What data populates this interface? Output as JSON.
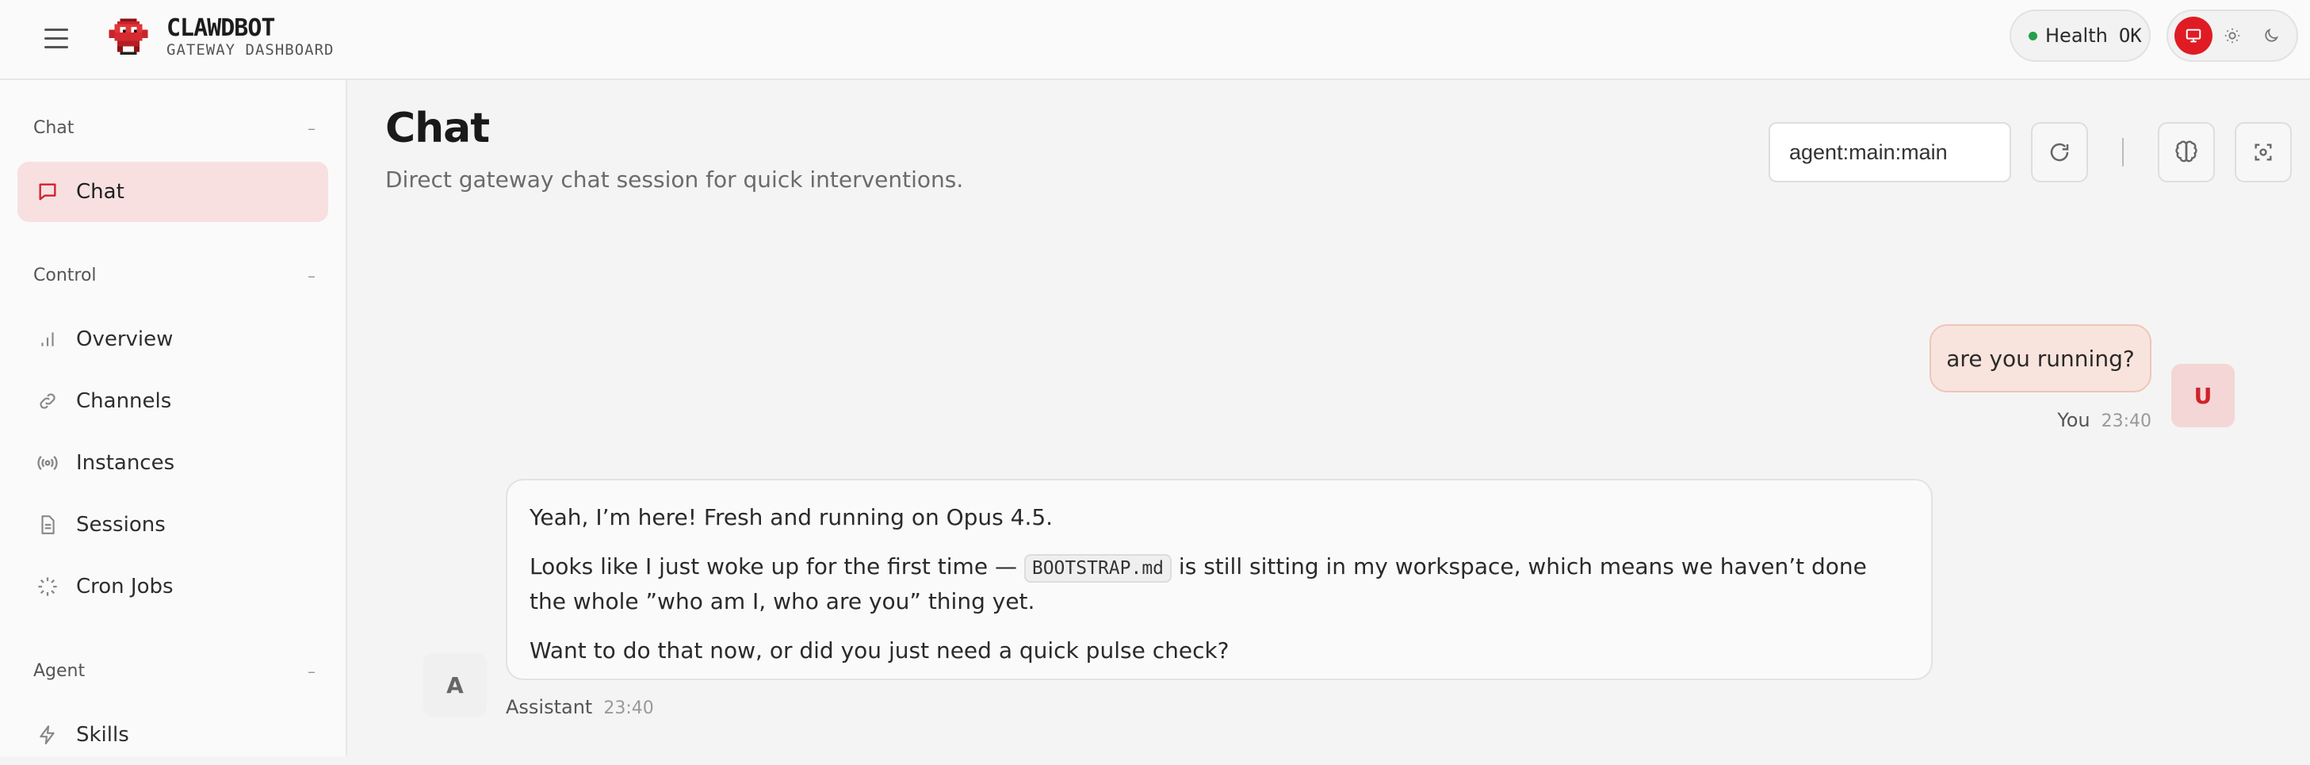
{
  "brand": {
    "title": "CLAWDBOT",
    "subtitle": "GATEWAY DASHBOARD"
  },
  "health": {
    "label": "Health",
    "value": "OK",
    "status_color": "#22a04b"
  },
  "theme": {
    "options": [
      "system-monitor-icon",
      "sun-icon",
      "moon-icon"
    ],
    "active": "system",
    "accent": "#e01b24"
  },
  "sidebar": {
    "sections": [
      {
        "label": "Chat",
        "collapse": "–",
        "items": [
          {
            "label": "Chat",
            "icon": "chat-bubble-icon",
            "active": true
          }
        ]
      },
      {
        "label": "Control",
        "collapse": "–",
        "items": [
          {
            "label": "Overview",
            "icon": "bar-chart-icon"
          },
          {
            "label": "Channels",
            "icon": "link-icon"
          },
          {
            "label": "Instances",
            "icon": "radio-broadcast-icon"
          },
          {
            "label": "Sessions",
            "icon": "document-icon"
          },
          {
            "label": "Cron Jobs",
            "icon": "loader-icon"
          }
        ]
      },
      {
        "label": "Agent",
        "collapse": "–",
        "items": [
          {
            "label": "Skills",
            "icon": "lightning-icon"
          }
        ]
      }
    ]
  },
  "main": {
    "title": "Chat",
    "subtitle": "Direct gateway chat session for quick interventions.",
    "session_value": "agent:main:main"
  },
  "messages": [
    {
      "role": "user",
      "avatar": "U",
      "name": "You",
      "time": "23:40",
      "text": "are you running?"
    },
    {
      "role": "assistant",
      "avatar": "A",
      "name": "Assistant",
      "time": "23:40",
      "p1": "Yeah, I’m here! Fresh and running on Opus 4.5.",
      "p2_before": "Looks like I just woke up for the first time — ",
      "p2_code": "BOOTSTRAP.md",
      "p2_after": " is still sitting in my workspace, which means we haven’t done the whole ”who am I, who are you” thing yet.",
      "p3": "Want to do that now, or did you just need a quick pulse check?"
    }
  ]
}
